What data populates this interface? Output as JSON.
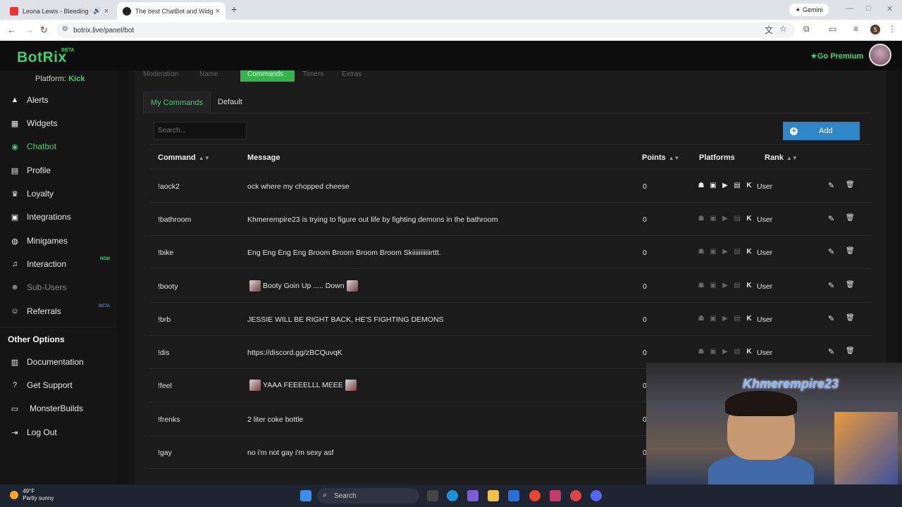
{
  "browser": {
    "tabs": [
      {
        "title": "Leona Lewis - Bleeding Lov",
        "close": "×"
      },
      {
        "title": "The best ChatBot and Widgets",
        "close": "×"
      }
    ],
    "new_tab": "+",
    "gemini": "Gemini",
    "url": "botrix.live/panel/bot",
    "profile_initial": "S"
  },
  "app": {
    "logo": "BotRix",
    "logo_badge": "BETA",
    "go_premium": "Go Premium"
  },
  "sidebar": {
    "platform_label": "Platform:",
    "platform_value": "Kick",
    "items": [
      {
        "label": "Alerts",
        "icon": "warning-icon"
      },
      {
        "label": "Widgets",
        "icon": "grid-icon"
      },
      {
        "label": "Chatbot",
        "icon": "robot-icon"
      },
      {
        "label": "Profile",
        "icon": "id-card-icon"
      },
      {
        "label": "Loyalty",
        "icon": "trophy-icon"
      },
      {
        "label": "Integrations",
        "icon": "integrations-icon"
      },
      {
        "label": "Minigames",
        "icon": "gamepad-icon"
      },
      {
        "label": "Interaction",
        "icon": "music-icon",
        "badge": "NEW"
      },
      {
        "label": "Sub-Users",
        "icon": "users-icon"
      },
      {
        "label": "Referrals",
        "icon": "referrals-icon",
        "badge": "BETA"
      }
    ],
    "other_title": "Other Options",
    "other_items": [
      {
        "label": "Documentation",
        "icon": "book-icon"
      },
      {
        "label": "Get Support",
        "icon": "help-icon"
      },
      {
        "label": "MonsterBuilds",
        "icon": "laptop-icon"
      },
      {
        "label": "Log Out",
        "icon": "logout-icon"
      }
    ]
  },
  "main": {
    "top_tabs": [
      "Moderation",
      "Name",
      "Commands",
      "Timers",
      "Extras"
    ],
    "sub_tabs": [
      "My Commands",
      "Default"
    ],
    "search_placeholder": "Search...",
    "add_label": "Add",
    "columns": [
      "Command",
      "Message",
      "Points",
      "Platforms",
      "Rank"
    ],
    "rows": [
      {
        "command": "!aock2",
        "message": "ock where my chopped cheese",
        "points": "0",
        "rank": "User",
        "platforms_on": true
      },
      {
        "command": "!bathroom",
        "message": "Khmerempire23 is trying to figure out life by fighting demons in the bathroom",
        "points": "0",
        "rank": "User",
        "platforms_on": false
      },
      {
        "command": "!bike",
        "message": "Eng Eng Eng Eng Broom Broom Broom Broom Skiiiiiiiiiiirttt.",
        "points": "0",
        "rank": "User",
        "platforms_on": false
      },
      {
        "command": "!booty",
        "message": "Booty Goin Up ..... Down",
        "points": "0",
        "rank": "User",
        "platforms_on": false,
        "emotes": true
      },
      {
        "command": "!brb",
        "message": "JESSIE WILL BE RIGHT BACK, HE'S FIGHTING DEMONS",
        "points": "0",
        "rank": "User",
        "platforms_on": false
      },
      {
        "command": "!dis",
        "message": "https://discord.gg/zBCQuvqK",
        "points": "0",
        "rank": "User",
        "platforms_on": false
      },
      {
        "command": "!feel",
        "message": "YAAA FEEEELLL MEEE",
        "points": "0",
        "rank": "",
        "platforms_on": false,
        "emotes": true
      },
      {
        "command": "!frenks",
        "message": "2 liter coke bottle",
        "points": "0",
        "rank": "",
        "platforms_on": false
      },
      {
        "command": "!gay",
        "message": "no i'm not gay i'm sexy asf",
        "points": "0",
        "rank": "",
        "platforms_on": false
      }
    ]
  },
  "webcam": {
    "overlay_text": "Khmerempire23"
  },
  "taskbar": {
    "temperature": "49°F",
    "condition": "Partly sunny",
    "search": "Search"
  }
}
